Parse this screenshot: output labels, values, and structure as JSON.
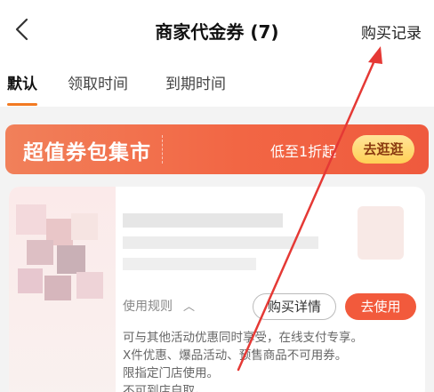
{
  "nav": {
    "back_icon": "chevron-left-icon",
    "title": "商家代金券 (7)",
    "history_label": "购买记录"
  },
  "tabs": [
    {
      "label": "默认",
      "active": true
    },
    {
      "label": "领取时间",
      "active": false
    },
    {
      "label": "到期时间",
      "active": false
    }
  ],
  "banner": {
    "title": "超值券包集市",
    "subtitle": "低至1折起",
    "button_label": "去逛逛"
  },
  "coupon": {
    "rules_label": "使用规则",
    "rules_toggle_icon": "chevron-up-icon",
    "detail_button": "购买详情",
    "use_button": "去使用",
    "rules": [
      "可与其他活动优惠同时享受，在线支付专享。",
      "X件优惠、爆品活动、预售商品不可用券。",
      "限指定门店使用。",
      "不可到店自取。"
    ]
  },
  "colors": {
    "accent": "#f27a22",
    "banner": "#f26644",
    "use_button": "#f25a3c",
    "annotation_arrow": "#e53935"
  }
}
